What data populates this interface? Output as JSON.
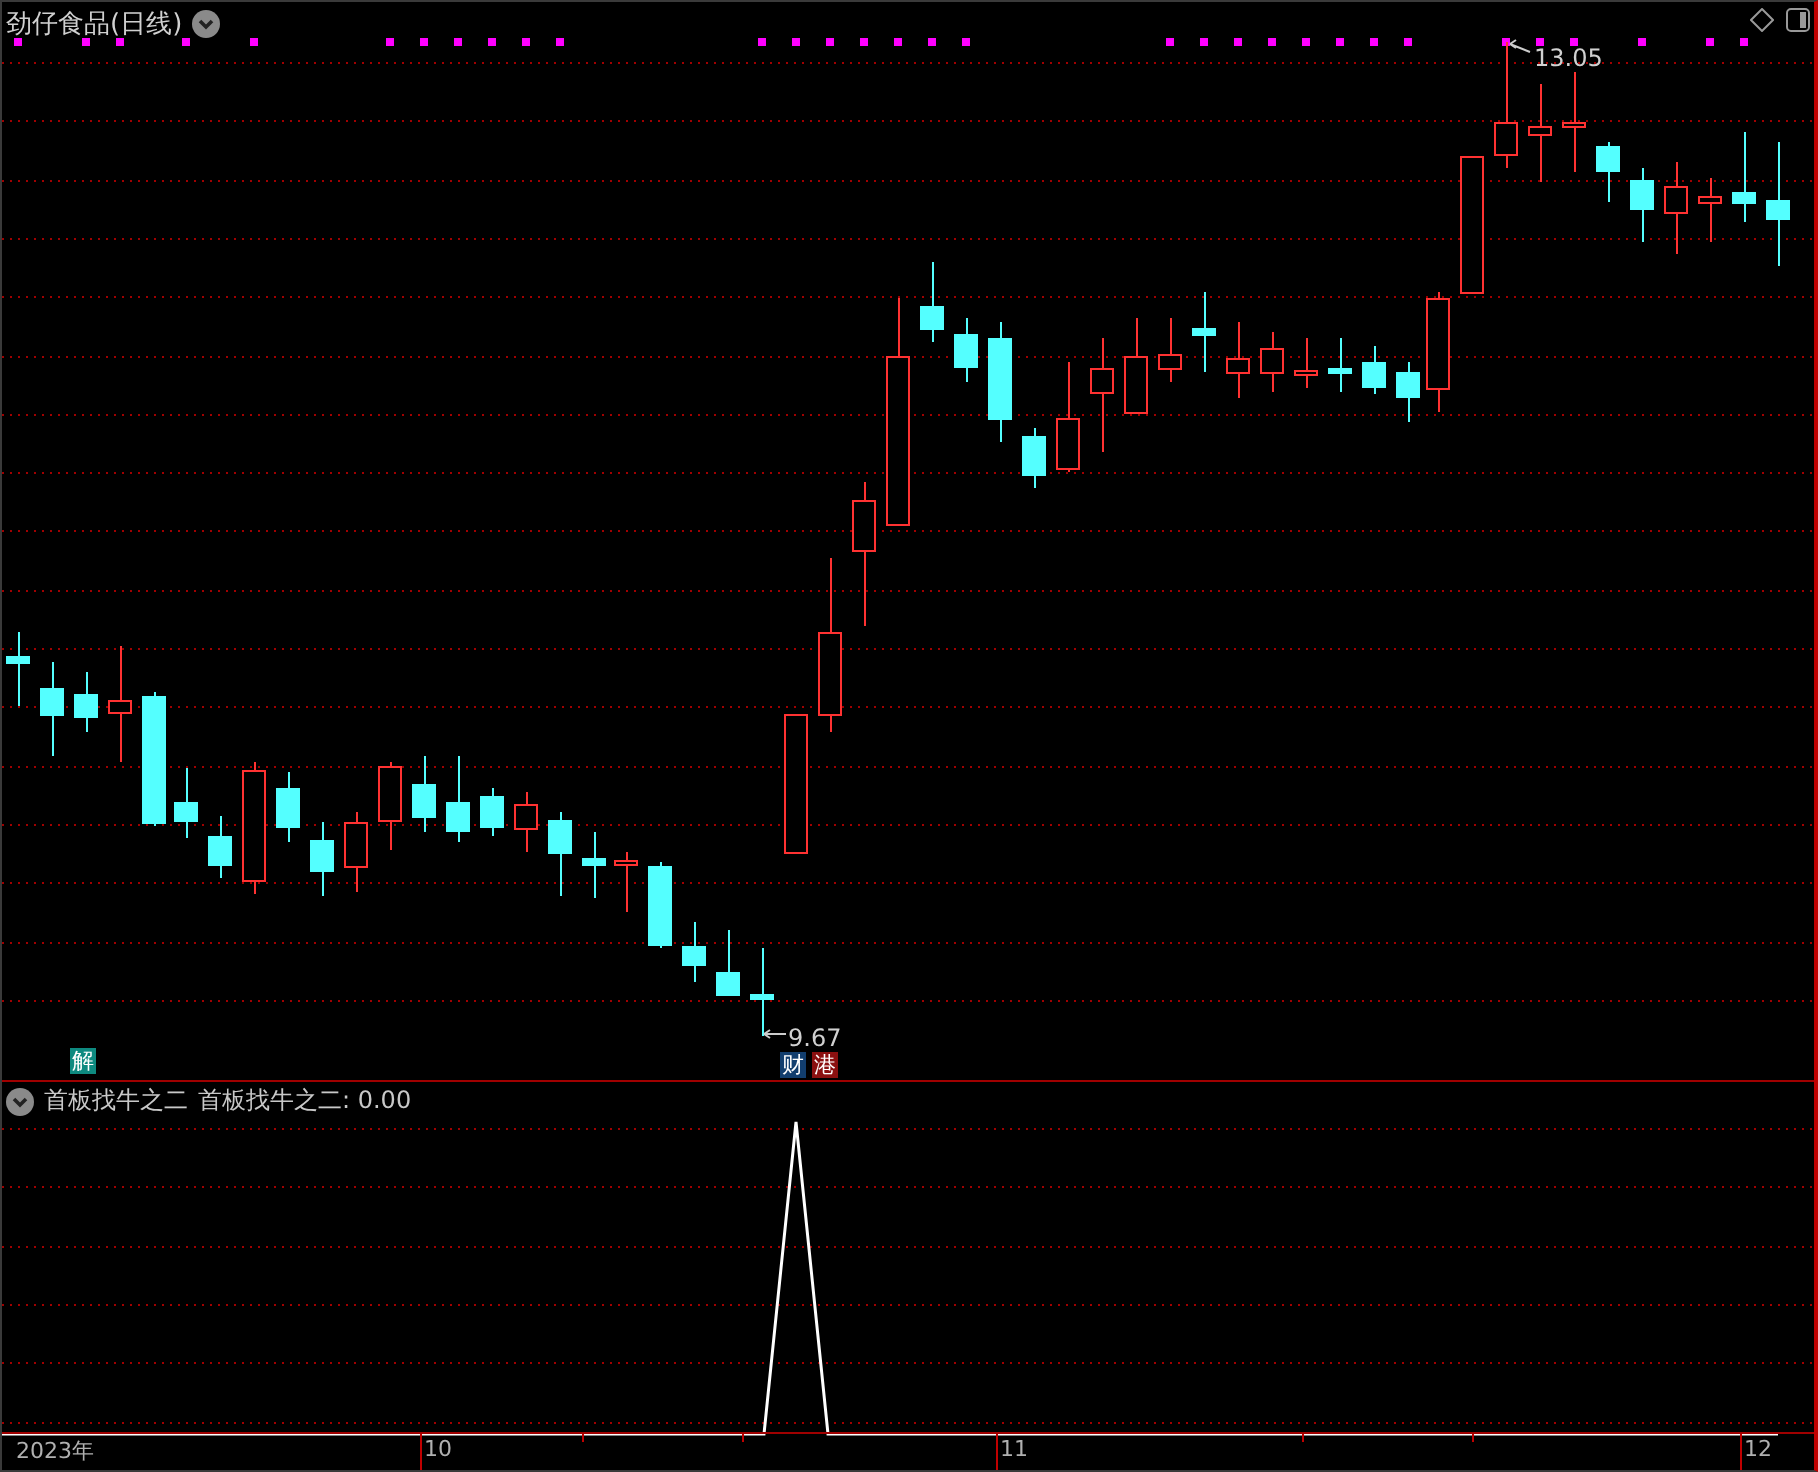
{
  "chart": {
    "title": "劲仔食品(日线)",
    "high_label": "13.05",
    "low_label": "9.67",
    "badges": [
      {
        "text": "解",
        "color": "#0e8a80"
      },
      {
        "text": "财",
        "color": "#123e6e"
      },
      {
        "text": "港",
        "color": "#8b1010"
      }
    ]
  },
  "indicator": {
    "name": "首板找牛之二",
    "value_label": "首板找牛之二: 0.00"
  },
  "time_axis": [
    "2023年",
    "10",
    "11",
    "12"
  ]
}
